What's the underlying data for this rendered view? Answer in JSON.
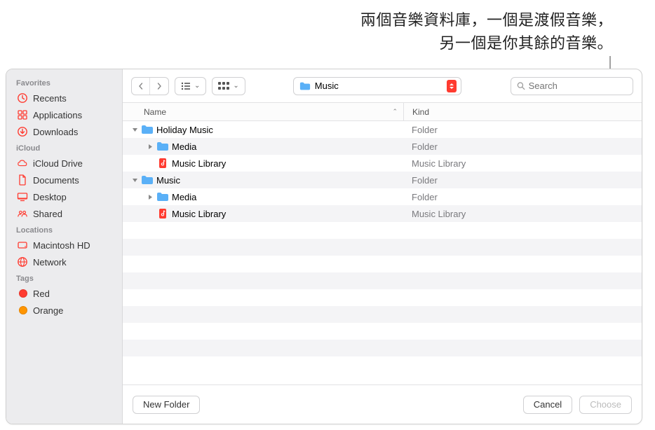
{
  "annotation": {
    "line1": "兩個音樂資料庫，一個是渡假音樂，",
    "line2": "另一個是你其餘的音樂。"
  },
  "sidebar": {
    "sections": [
      {
        "title": "Favorites",
        "items": [
          {
            "label": "Recents",
            "icon": "clock"
          },
          {
            "label": "Applications",
            "icon": "app-grid"
          },
          {
            "label": "Downloads",
            "icon": "download"
          }
        ]
      },
      {
        "title": "iCloud",
        "items": [
          {
            "label": "iCloud Drive",
            "icon": "cloud"
          },
          {
            "label": "Documents",
            "icon": "doc"
          },
          {
            "label": "Desktop",
            "icon": "desktop"
          },
          {
            "label": "Shared",
            "icon": "shared"
          }
        ]
      },
      {
        "title": "Locations",
        "items": [
          {
            "label": "Macintosh HD",
            "icon": "disk"
          },
          {
            "label": "Network",
            "icon": "globe"
          }
        ]
      },
      {
        "title": "Tags",
        "items": [
          {
            "label": "Red",
            "icon": "tag",
            "color": "#ff3b30"
          },
          {
            "label": "Orange",
            "icon": "tag",
            "color": "#ff9500"
          }
        ]
      }
    ]
  },
  "toolbar": {
    "path_label": "Music",
    "search_placeholder": "Search"
  },
  "columns": {
    "name": "Name",
    "kind": "Kind"
  },
  "rows": [
    {
      "indent": 0,
      "disclosure": "open",
      "icon": "folder",
      "name": "Holiday Music",
      "kind": "Folder"
    },
    {
      "indent": 1,
      "disclosure": "closed",
      "icon": "folder",
      "name": "Media",
      "kind": "Folder"
    },
    {
      "indent": 1,
      "disclosure": "none",
      "icon": "music-lib",
      "name": "Music Library",
      "kind": "Music Library"
    },
    {
      "indent": 0,
      "disclosure": "open",
      "icon": "folder",
      "name": "Music",
      "kind": "Folder"
    },
    {
      "indent": 1,
      "disclosure": "closed",
      "icon": "folder",
      "name": "Media",
      "kind": "Folder"
    },
    {
      "indent": 1,
      "disclosure": "none",
      "icon": "music-lib",
      "name": "Music Library",
      "kind": "Music Library"
    }
  ],
  "footer": {
    "new_folder": "New Folder",
    "cancel": "Cancel",
    "choose": "Choose"
  },
  "colors": {
    "sidebar_icon": "#ff3b30",
    "folder": "#5ab0f7"
  }
}
